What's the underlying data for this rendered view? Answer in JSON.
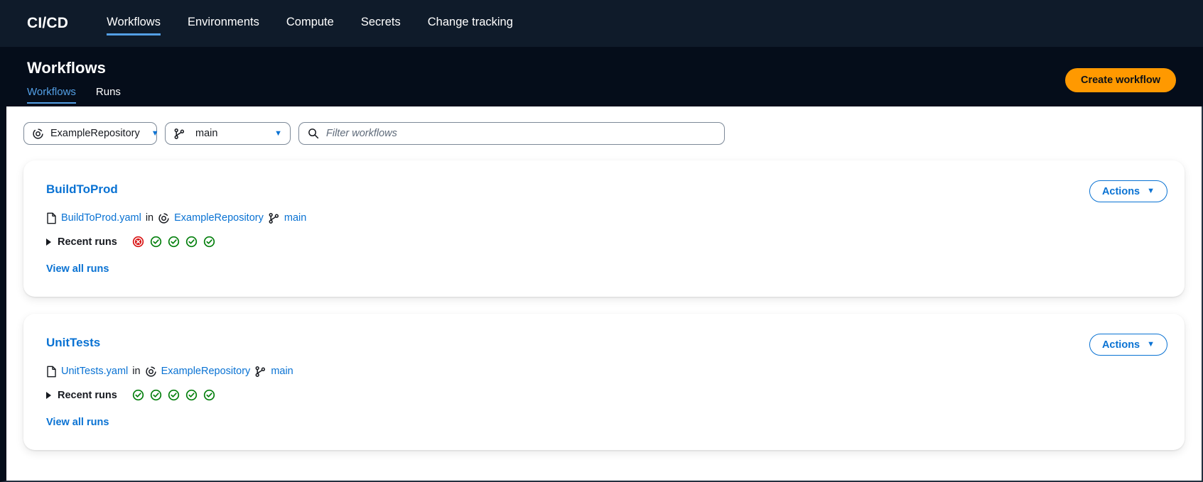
{
  "topnav": {
    "brand": "CI/CD",
    "items": [
      {
        "label": "Workflows",
        "active": true
      },
      {
        "label": "Environments",
        "active": false
      },
      {
        "label": "Compute",
        "active": false
      },
      {
        "label": "Secrets",
        "active": false
      },
      {
        "label": "Change tracking",
        "active": false
      }
    ]
  },
  "pagehead": {
    "title": "Workflows",
    "tabs": [
      {
        "label": "Workflows",
        "active": true
      },
      {
        "label": "Runs",
        "active": false
      }
    ],
    "create_button": "Create workflow"
  },
  "filters": {
    "repository": {
      "value": "ExampleRepository",
      "icon": "repository-icon"
    },
    "branch": {
      "value": "main",
      "icon": "branch-icon"
    },
    "search": {
      "placeholder": "Filter workflows",
      "value": "",
      "icon": "search-icon"
    }
  },
  "colors": {
    "topnav_bg": "#0f1b2a",
    "pagehead_bg": "#050d1a",
    "accent_link": "#0972d3",
    "accent_button": "#ff9900",
    "tab_underline": "#539fe5",
    "status_success": "#037f0c",
    "status_failed": "#d91515"
  },
  "workflows": [
    {
      "name": "BuildToProd",
      "file": "BuildToProd.yaml",
      "in_label": "in",
      "repository": "ExampleRepository",
      "branch": "main",
      "runs_label": "Recent runs",
      "view_all_label": "View all runs",
      "actions_label": "Actions",
      "runs": [
        "failed",
        "success",
        "success",
        "success",
        "success"
      ]
    },
    {
      "name": "UnitTests",
      "file": "UnitTests.yaml",
      "in_label": "in",
      "repository": "ExampleRepository",
      "branch": "main",
      "runs_label": "Recent runs",
      "view_all_label": "View all runs",
      "actions_label": "Actions",
      "runs": [
        "success",
        "success",
        "success",
        "success",
        "success"
      ]
    }
  ]
}
